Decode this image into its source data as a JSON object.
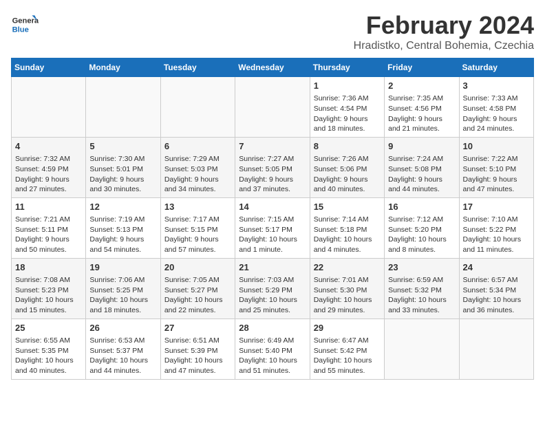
{
  "logo": {
    "general": "General",
    "blue": "Blue"
  },
  "header": {
    "month": "February 2024",
    "location": "Hradistko, Central Bohemia, Czechia"
  },
  "weekdays": [
    "Sunday",
    "Monday",
    "Tuesday",
    "Wednesday",
    "Thursday",
    "Friday",
    "Saturday"
  ],
  "weeks": [
    [
      {
        "day": "",
        "info": ""
      },
      {
        "day": "",
        "info": ""
      },
      {
        "day": "",
        "info": ""
      },
      {
        "day": "",
        "info": ""
      },
      {
        "day": "1",
        "info": "Sunrise: 7:36 AM\nSunset: 4:54 PM\nDaylight: 9 hours\nand 18 minutes."
      },
      {
        "day": "2",
        "info": "Sunrise: 7:35 AM\nSunset: 4:56 PM\nDaylight: 9 hours\nand 21 minutes."
      },
      {
        "day": "3",
        "info": "Sunrise: 7:33 AM\nSunset: 4:58 PM\nDaylight: 9 hours\nand 24 minutes."
      }
    ],
    [
      {
        "day": "4",
        "info": "Sunrise: 7:32 AM\nSunset: 4:59 PM\nDaylight: 9 hours\nand 27 minutes."
      },
      {
        "day": "5",
        "info": "Sunrise: 7:30 AM\nSunset: 5:01 PM\nDaylight: 9 hours\nand 30 minutes."
      },
      {
        "day": "6",
        "info": "Sunrise: 7:29 AM\nSunset: 5:03 PM\nDaylight: 9 hours\nand 34 minutes."
      },
      {
        "day": "7",
        "info": "Sunrise: 7:27 AM\nSunset: 5:05 PM\nDaylight: 9 hours\nand 37 minutes."
      },
      {
        "day": "8",
        "info": "Sunrise: 7:26 AM\nSunset: 5:06 PM\nDaylight: 9 hours\nand 40 minutes."
      },
      {
        "day": "9",
        "info": "Sunrise: 7:24 AM\nSunset: 5:08 PM\nDaylight: 9 hours\nand 44 minutes."
      },
      {
        "day": "10",
        "info": "Sunrise: 7:22 AM\nSunset: 5:10 PM\nDaylight: 9 hours\nand 47 minutes."
      }
    ],
    [
      {
        "day": "11",
        "info": "Sunrise: 7:21 AM\nSunset: 5:11 PM\nDaylight: 9 hours\nand 50 minutes."
      },
      {
        "day": "12",
        "info": "Sunrise: 7:19 AM\nSunset: 5:13 PM\nDaylight: 9 hours\nand 54 minutes."
      },
      {
        "day": "13",
        "info": "Sunrise: 7:17 AM\nSunset: 5:15 PM\nDaylight: 9 hours\nand 57 minutes."
      },
      {
        "day": "14",
        "info": "Sunrise: 7:15 AM\nSunset: 5:17 PM\nDaylight: 10 hours\nand 1 minute."
      },
      {
        "day": "15",
        "info": "Sunrise: 7:14 AM\nSunset: 5:18 PM\nDaylight: 10 hours\nand 4 minutes."
      },
      {
        "day": "16",
        "info": "Sunrise: 7:12 AM\nSunset: 5:20 PM\nDaylight: 10 hours\nand 8 minutes."
      },
      {
        "day": "17",
        "info": "Sunrise: 7:10 AM\nSunset: 5:22 PM\nDaylight: 10 hours\nand 11 minutes."
      }
    ],
    [
      {
        "day": "18",
        "info": "Sunrise: 7:08 AM\nSunset: 5:23 PM\nDaylight: 10 hours\nand 15 minutes."
      },
      {
        "day": "19",
        "info": "Sunrise: 7:06 AM\nSunset: 5:25 PM\nDaylight: 10 hours\nand 18 minutes."
      },
      {
        "day": "20",
        "info": "Sunrise: 7:05 AM\nSunset: 5:27 PM\nDaylight: 10 hours\nand 22 minutes."
      },
      {
        "day": "21",
        "info": "Sunrise: 7:03 AM\nSunset: 5:29 PM\nDaylight: 10 hours\nand 25 minutes."
      },
      {
        "day": "22",
        "info": "Sunrise: 7:01 AM\nSunset: 5:30 PM\nDaylight: 10 hours\nand 29 minutes."
      },
      {
        "day": "23",
        "info": "Sunrise: 6:59 AM\nSunset: 5:32 PM\nDaylight: 10 hours\nand 33 minutes."
      },
      {
        "day": "24",
        "info": "Sunrise: 6:57 AM\nSunset: 5:34 PM\nDaylight: 10 hours\nand 36 minutes."
      }
    ],
    [
      {
        "day": "25",
        "info": "Sunrise: 6:55 AM\nSunset: 5:35 PM\nDaylight: 10 hours\nand 40 minutes."
      },
      {
        "day": "26",
        "info": "Sunrise: 6:53 AM\nSunset: 5:37 PM\nDaylight: 10 hours\nand 44 minutes."
      },
      {
        "day": "27",
        "info": "Sunrise: 6:51 AM\nSunset: 5:39 PM\nDaylight: 10 hours\nand 47 minutes."
      },
      {
        "day": "28",
        "info": "Sunrise: 6:49 AM\nSunset: 5:40 PM\nDaylight: 10 hours\nand 51 minutes."
      },
      {
        "day": "29",
        "info": "Sunrise: 6:47 AM\nSunset: 5:42 PM\nDaylight: 10 hours\nand 55 minutes."
      },
      {
        "day": "",
        "info": ""
      },
      {
        "day": "",
        "info": ""
      }
    ]
  ]
}
